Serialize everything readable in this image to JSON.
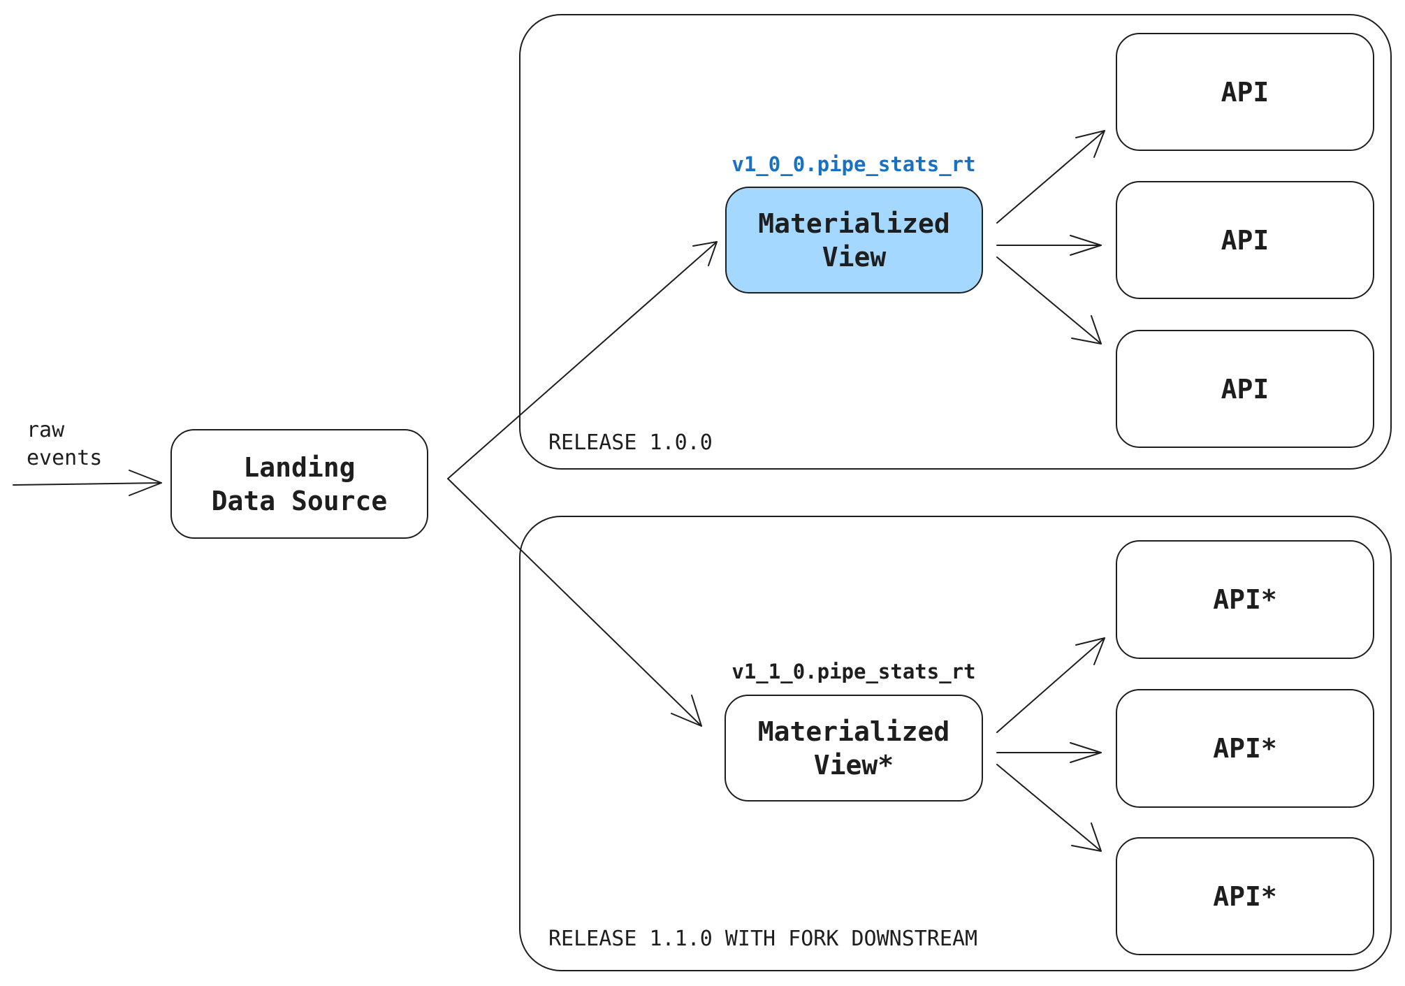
{
  "input": {
    "label_line1": "raw",
    "label_line2": "events"
  },
  "landing": {
    "label": "Landing\nData Source"
  },
  "releases": [
    {
      "label": "RELEASE 1.0.0",
      "mv_caption": "v1_0_0.pipe_stats_rt",
      "mv_caption_color": "#1971c2",
      "mv_label": "Materialized\nView",
      "mv_fill": "#a5d8ff",
      "apis": [
        "API",
        "API",
        "API"
      ]
    },
    {
      "label": "RELEASE 1.1.0 WITH FORK DOWNSTREAM",
      "mv_caption": "v1_1_0.pipe_stats_rt",
      "mv_caption_color": "#1e1e1e",
      "mv_label": "Materialized\nView*",
      "mv_fill": "#ffffff",
      "apis": [
        "API*",
        "API*",
        "API*"
      ]
    }
  ]
}
